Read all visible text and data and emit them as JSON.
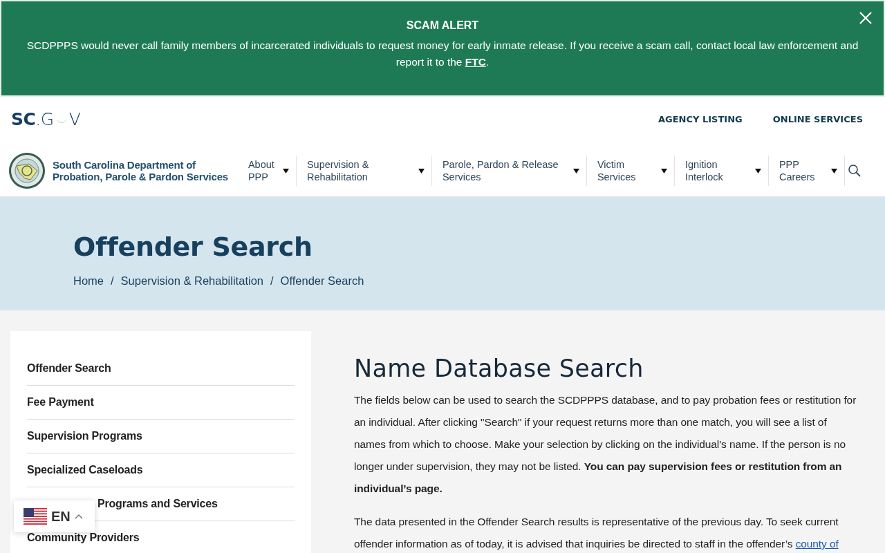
{
  "alert": {
    "title": "SCAM ALERT",
    "message": [
      {
        "kind": "plain",
        "text": "SCDPPPS would never call family members of incarcerated individuals to request money for early inmate release. If you receive a scam call, contact local law enforcement and report it to the "
      },
      {
        "kind": "link",
        "text": "FTC"
      },
      {
        "kind": "plain",
        "text": "."
      }
    ]
  },
  "top_bar": {
    "logo": {
      "bold": "SC",
      "rest": ".G",
      "end": "V"
    },
    "links": [
      "AGENCY LISTING",
      "ONLINE SERVICES"
    ]
  },
  "agency": {
    "name_lines": [
      "South Carolina Department of",
      "Probation, Parole & Pardon Services"
    ]
  },
  "nav": [
    {
      "label": "About PPP"
    },
    {
      "label": "Supervision & Rehabilitation"
    },
    {
      "label": "Parole, Pardon & Release Services"
    },
    {
      "label": "Victim Services"
    },
    {
      "label": "Ignition Interlock"
    },
    {
      "label": "PPP Careers"
    }
  ],
  "hero": {
    "title": "Offender Search",
    "breadcrumbs": [
      {
        "label": "Home"
      },
      {
        "label": "Supervision & Rehabilitation",
        "separator": "/"
      },
      {
        "label": "Offender Search",
        "separator": "/"
      }
    ]
  },
  "sidebar": {
    "items": [
      {
        "label": "Offender Search"
      },
      {
        "label": "Fee Payment"
      },
      {
        "label": "Supervision Programs"
      },
      {
        "label": "Specialized Caseloads"
      },
      {
        "label": "Programs and Services",
        "covered": true
      },
      {
        "label": "Community Providers"
      }
    ]
  },
  "main": {
    "title": "Name Database Search",
    "paragraphs": [
      [
        {
          "kind": "plain",
          "text": "The fields below can be used to search the SCDPPPS database, and to pay probation fees or restitution for an individual. After clicking \"Search\" if your request returns more than one match, you will see a list of names from which to choose.  Make your selection by clicking on the individual's name.  If the person is no longer under supervision, they may not be listed. "
        },
        {
          "kind": "bold",
          "text": "You can pay supervision fees or restitution from an individual’s page."
        }
      ],
      [
        {
          "kind": "plain",
          "text": "The data presented in the Offender Search results is representative of the previous day. To seek current offender information as of today, it is advised that inquiries be directed to staff in the offender’s "
        },
        {
          "kind": "link",
          "text": "county of"
        }
      ]
    ]
  },
  "language": {
    "code": "EN"
  }
}
